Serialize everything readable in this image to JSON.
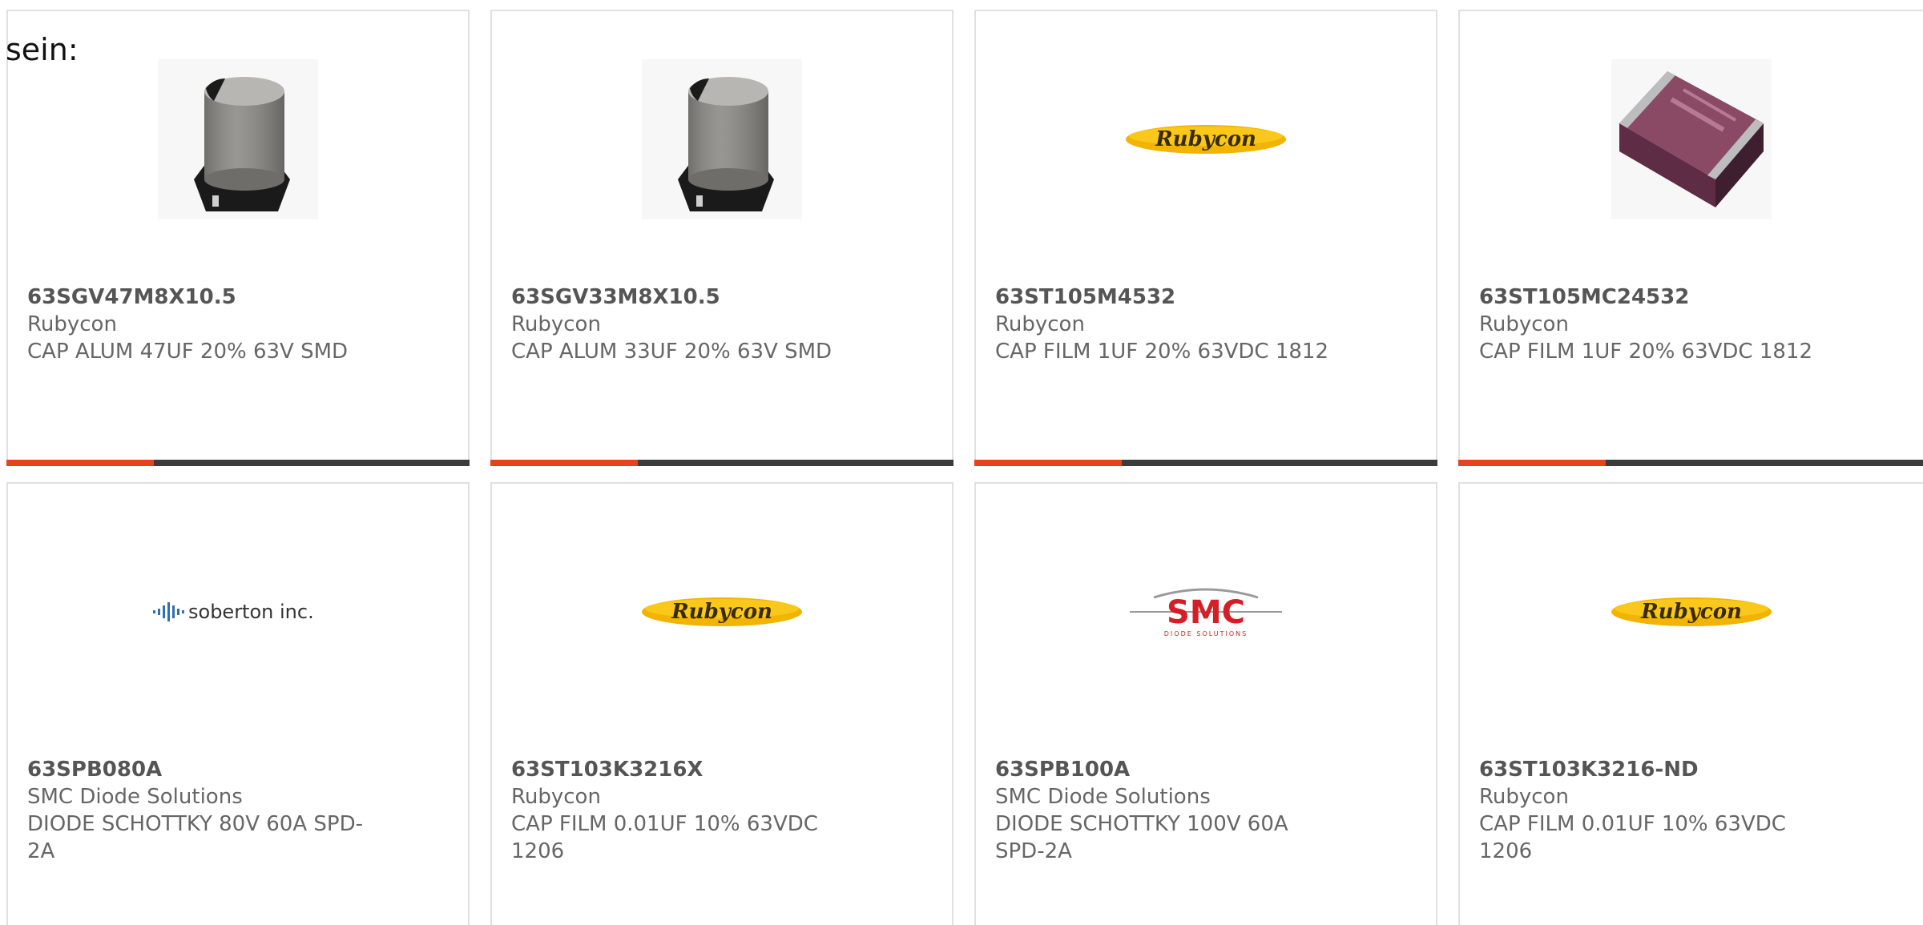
{
  "intro_text": "sein:",
  "colors": {
    "accent": "#e8421a",
    "bar": "#3b3b3b",
    "border": "#e0e0e0",
    "text": "#666666"
  },
  "products": [
    {
      "part_number": "63SGV47M8X10.5",
      "manufacturer": "Rubycon",
      "description": "CAP ALUM 47UF 20% 63V SMD",
      "image": "aluminum-capacitor-image"
    },
    {
      "part_number": "63SGV33M8X10.5",
      "manufacturer": "Rubycon",
      "description": "CAP ALUM 33UF 20% 63V SMD",
      "image": "aluminum-capacitor-image"
    },
    {
      "part_number": "63ST105M4532",
      "manufacturer": "Rubycon",
      "description": "CAP FILM 1UF 20% 63VDC 1812",
      "image": "rubycon-logo",
      "logo_text": "Rubycon"
    },
    {
      "part_number": "63ST105MC24532",
      "manufacturer": "Rubycon",
      "description": "CAP FILM 1UF 20% 63VDC 1812",
      "image": "film-capacitor-image"
    },
    {
      "part_number": "63SPB080A",
      "manufacturer": "SMC Diode Solutions",
      "description": "DIODE SCHOTTKY 80V 60A SPD-2A",
      "image": "soberton-logo",
      "logo_text": "soberton inc."
    },
    {
      "part_number": "63ST103K3216X",
      "manufacturer": "Rubycon",
      "description": "CAP FILM 0.01UF 10% 63VDC 1206",
      "image": "rubycon-logo",
      "logo_text": "Rubycon"
    },
    {
      "part_number": "63SPB100A",
      "manufacturer": "SMC Diode Solutions",
      "description": "DIODE SCHOTTKY 100V 60A SPD-2A",
      "image": "smc-logo",
      "logo_text": "SMC",
      "logo_subtext": "DIODE SOLUTIONS"
    },
    {
      "part_number": "63ST103K3216-ND",
      "manufacturer": "Rubycon",
      "description": "CAP FILM 0.01UF 10% 63VDC 1206",
      "image": "rubycon-logo",
      "logo_text": "Rubycon"
    }
  ]
}
